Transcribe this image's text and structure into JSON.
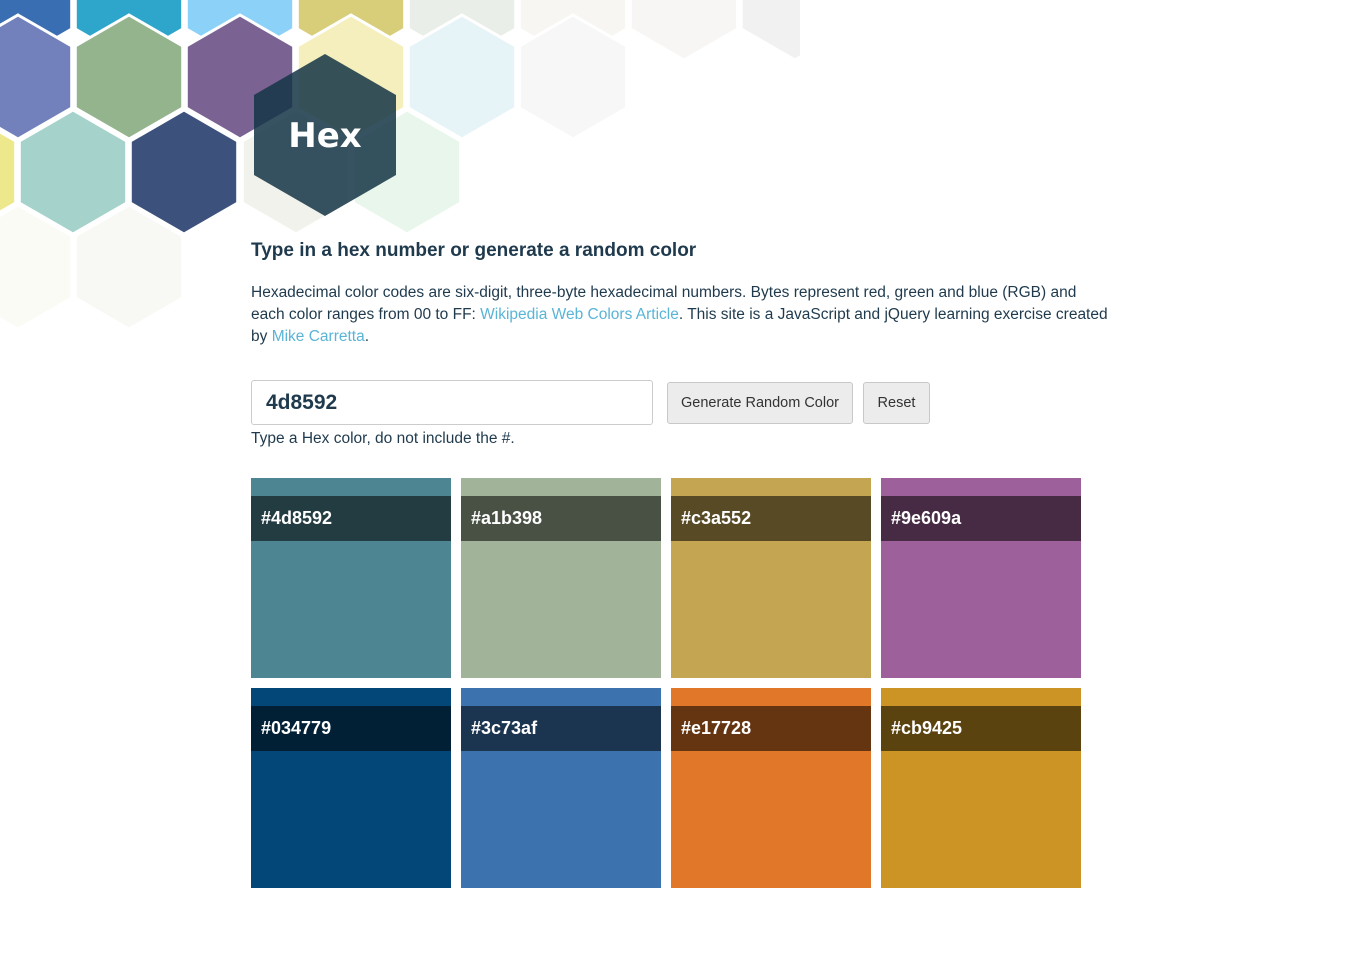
{
  "logo": {
    "text": "Hex",
    "icon": "hexagon-logo-icon",
    "color": "#163546"
  },
  "background_hexes": [
    "#3a6eb3",
    "#2ea6cc",
    "#8cd1f7",
    "#d8cd78",
    "#e9eee8",
    "#f8f6f2",
    "#f7f6f4",
    "#f1f1f1",
    "#7280bc",
    "#93b48d",
    "#7a6292",
    "#f4efbc",
    "#e6f4f8",
    "#f7f7f7",
    "#eee88c",
    "#a5d2cb",
    "#3c517c",
    "#f2f2ec",
    "#e9f6ec",
    "#f9fbf4",
    "#f8f9f5"
  ],
  "heading": "Type in a hex number or generate a random color",
  "intro": {
    "text_1": "Hexadecimal color codes are six-digit, three-byte hexadecimal numbers. Bytes represent red, green and blue (RGB) and each color ranges from 00 to FF: ",
    "link_1": "Wikipedia Web Colors Article",
    "text_2": ". This site is a JavaScript and jQuery learning exercise created by ",
    "link_2": "Mike Carretta",
    "text_3": ".",
    "link_color": "#5ab4d6"
  },
  "input": {
    "value": "4d8592"
  },
  "buttons": {
    "random": "Generate Random Color",
    "reset": "Reset"
  },
  "hint": "Type a Hex color, do not include the #.",
  "swatches": [
    {
      "label": "#4d8592",
      "color": "#4d8592"
    },
    {
      "label": "#a1b398",
      "color": "#a1b398"
    },
    {
      "label": "#c3a552",
      "color": "#c3a552"
    },
    {
      "label": "#9e609a",
      "color": "#9e609a"
    },
    {
      "label": "#034779",
      "color": "#034779"
    },
    {
      "label": "#3c73af",
      "color": "#3c73af"
    },
    {
      "label": "#e17728",
      "color": "#e17728"
    },
    {
      "label": "#cb9425",
      "color": "#cb9425"
    }
  ]
}
